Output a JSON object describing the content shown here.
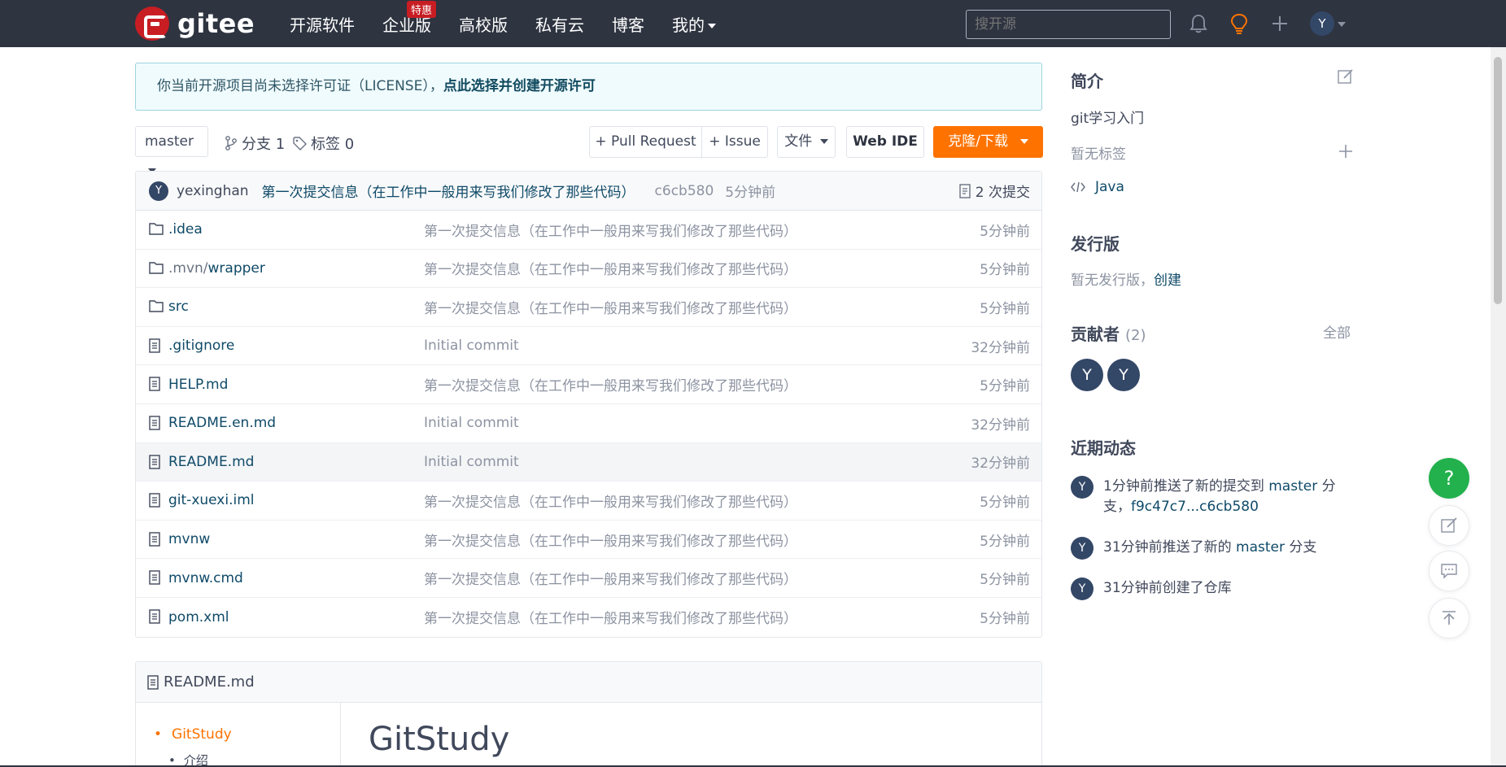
{
  "nav": {
    "logo_text": "gitee",
    "links": [
      "开源软件",
      "企业版",
      "高校版",
      "私有云",
      "博客"
    ],
    "badge": "特惠",
    "mine": "我的",
    "search_placeholder": "搜开源",
    "avatar_letter": "Y"
  },
  "notice": {
    "text": "你当前开源项目尚未选择许可证（LICENSE），",
    "link": "点此选择并创建开源许可"
  },
  "toolbar": {
    "branch": "master",
    "branches": "分支 1",
    "tags": "标签 0",
    "pull_request": "+ Pull Request",
    "issue": "+ Issue",
    "file": "文件",
    "web_ide": "Web IDE",
    "clone": "克隆/下载"
  },
  "commit": {
    "author": "yexinghan",
    "author_initial": "Y",
    "message": "第一次提交信息（在工作中一般用来写我们修改了那些代码）",
    "hash": "c6cb580",
    "time": "5分钟前",
    "count": "2 次提交"
  },
  "files": [
    {
      "name": ".idea",
      "type": "folder",
      "message": "第一次提交信息（在工作中一般用来写我们修改了那些代码）",
      "time": "5分钟前"
    },
    {
      "name_dim": ".mvn/",
      "name": "wrapper",
      "type": "folder",
      "message": "第一次提交信息（在工作中一般用来写我们修改了那些代码）",
      "time": "5分钟前"
    },
    {
      "name": "src",
      "type": "folder",
      "message": "第一次提交信息（在工作中一般用来写我们修改了那些代码）",
      "time": "5分钟前"
    },
    {
      "name": ".gitignore",
      "type": "file",
      "message": "Initial commit",
      "time": "32分钟前"
    },
    {
      "name": "HELP.md",
      "type": "file",
      "message": "第一次提交信息（在工作中一般用来写我们修改了那些代码）",
      "time": "5分钟前"
    },
    {
      "name": "README.en.md",
      "type": "file",
      "message": "Initial commit",
      "time": "32分钟前"
    },
    {
      "name": "README.md",
      "type": "file",
      "message": "Initial commit",
      "time": "32分钟前"
    },
    {
      "name": "git-xuexi.iml",
      "type": "file",
      "message": "第一次提交信息（在工作中一般用来写我们修改了那些代码）",
      "time": "5分钟前"
    },
    {
      "name": "mvnw",
      "type": "file",
      "message": "第一次提交信息（在工作中一般用来写我们修改了那些代码）",
      "time": "5分钟前"
    },
    {
      "name": "mvnw.cmd",
      "type": "file",
      "message": "第一次提交信息（在工作中一般用来写我们修改了那些代码）",
      "time": "5分钟前"
    },
    {
      "name": "pom.xml",
      "type": "file",
      "message": "第一次提交信息（在工作中一般用来写我们修改了那些代码）",
      "time": "5分钟前"
    }
  ],
  "readme": {
    "filename": "README.md",
    "toc_item": "GitStudy",
    "toc_sub": "介绍",
    "title": "GitStudy"
  },
  "sidebar": {
    "intro_title": "简介",
    "intro_text": "git学习入门",
    "no_tags": "暂无标签",
    "language": "Java",
    "release_title": "发行版",
    "no_release": "暂无发行版，",
    "create": "创建",
    "contributors_title": "贡献者",
    "contributors_count": "(2)",
    "all": "全部",
    "contributor_initials": [
      "Y",
      "Y"
    ],
    "activity_title": "近期动态",
    "activities": [
      {
        "pre": "1分钟前推送了新的提交到 ",
        "branch": "master",
        "post": " 分支，",
        "range": "f9c47c7...c6cb580"
      },
      {
        "pre": "31分钟前推送了新的 ",
        "branch": "master",
        "post": " 分支"
      },
      {
        "pre": "31分钟前创建了仓库"
      }
    ]
  },
  "float": {
    "help": "?"
  },
  "colors": {
    "nav_bg": "#2e3440",
    "accent_orange": "#fe7300",
    "link": "#0f4a68",
    "help_green": "#22b14c"
  }
}
